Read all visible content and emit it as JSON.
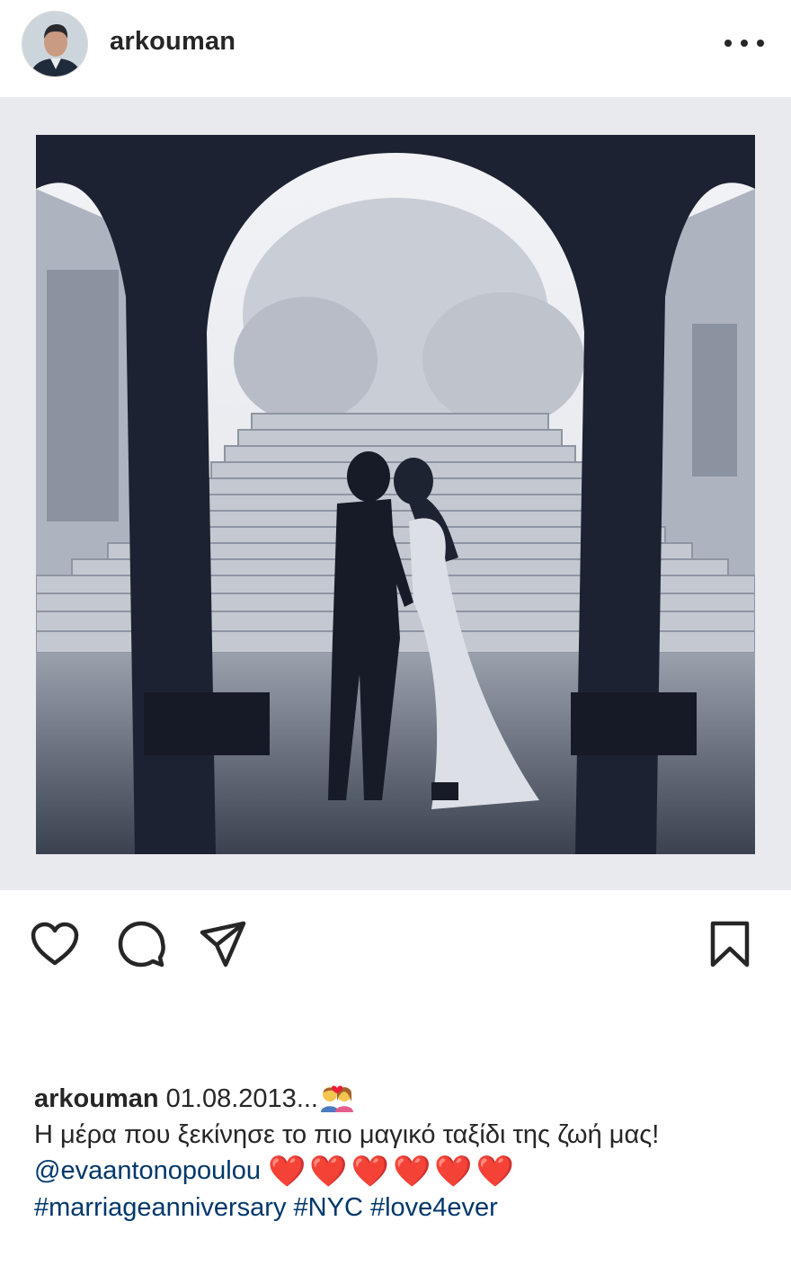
{
  "post": {
    "username": "arkouman",
    "more_icon": "more-horizontal-icon"
  },
  "actions": {
    "like_icon": "heart-icon",
    "comment_icon": "comment-icon",
    "share_icon": "send-icon",
    "save_icon": "bookmark-icon"
  },
  "caption": {
    "username": "arkouman",
    "date": "01.08.2013...",
    "emoji": "couple-with-heart",
    "text": "Η μέρα που ξεκίνησε το πιο μαγικό ταξίδι της ζωή μας!",
    "mention": "@evaantonopoulou",
    "hearts": "❤️❤️❤️❤️❤️❤️",
    "hashtags": [
      "#marriageanniversary",
      "#NYC",
      "#love4ever"
    ]
  },
  "colors": {
    "text": "#262626",
    "link": "#00376b",
    "heart": "#ed1d3a",
    "image_border": "#e9eaee"
  }
}
